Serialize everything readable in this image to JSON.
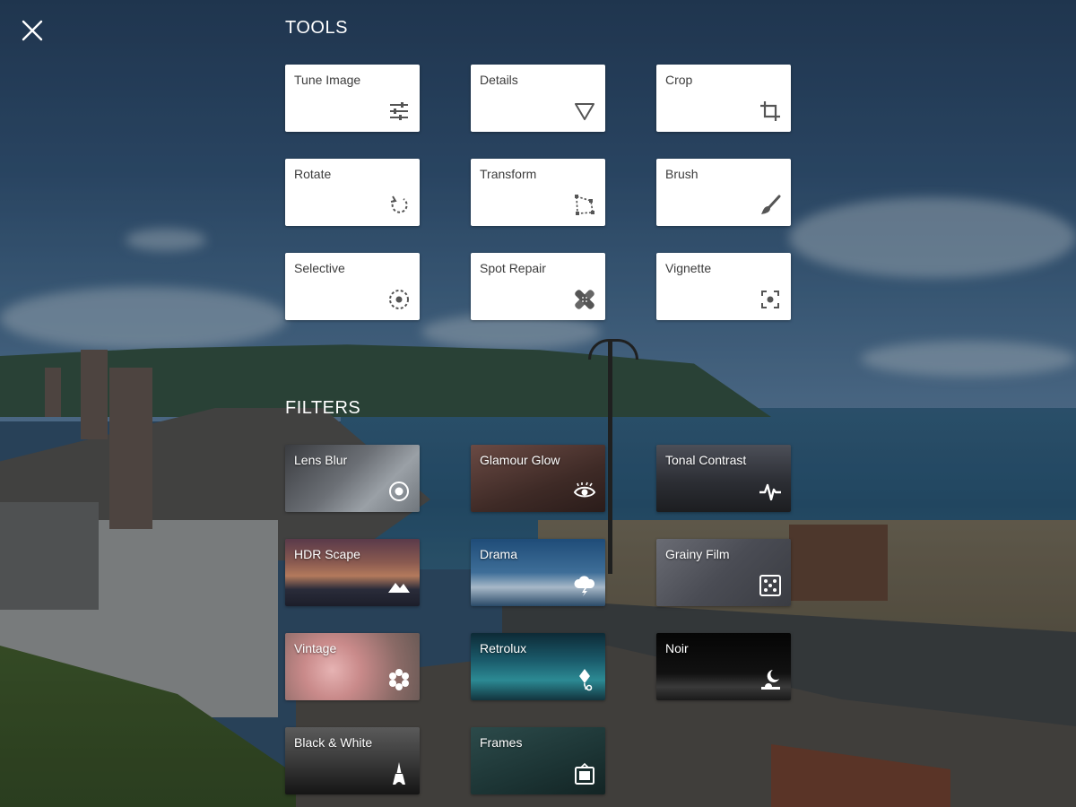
{
  "header": {
    "close_icon": "close-icon"
  },
  "tools": {
    "title": "TOOLS",
    "items": [
      {
        "label": "Tune Image",
        "icon": "sliders-icon"
      },
      {
        "label": "Details",
        "icon": "triangle-down-icon"
      },
      {
        "label": "Crop",
        "icon": "crop-icon"
      },
      {
        "label": "Rotate",
        "icon": "rotate-icon"
      },
      {
        "label": "Transform",
        "icon": "transform-icon"
      },
      {
        "label": "Brush",
        "icon": "brush-icon"
      },
      {
        "label": "Selective",
        "icon": "selective-target-icon"
      },
      {
        "label": "Spot Repair",
        "icon": "bandage-icon"
      },
      {
        "label": "Vignette",
        "icon": "vignette-icon"
      }
    ]
  },
  "filters": {
    "title": "FILTERS",
    "items": [
      {
        "label": "Lens Blur",
        "icon": "lens-blur-icon"
      },
      {
        "label": "Glamour Glow",
        "icon": "eye-icon"
      },
      {
        "label": "Tonal Contrast",
        "icon": "pulse-icon"
      },
      {
        "label": "HDR Scape",
        "icon": "mountains-icon"
      },
      {
        "label": "Drama",
        "icon": "storm-cloud-icon"
      },
      {
        "label": "Grainy Film",
        "icon": "dice-icon"
      },
      {
        "label": "Vintage",
        "icon": "flower-icon"
      },
      {
        "label": "Retrolux",
        "icon": "kite-icon"
      },
      {
        "label": "Noir",
        "icon": "moon-icon"
      },
      {
        "label": "Black & White",
        "icon": "eiffel-tower-icon"
      },
      {
        "label": "Frames",
        "icon": "frame-icon"
      }
    ]
  }
}
